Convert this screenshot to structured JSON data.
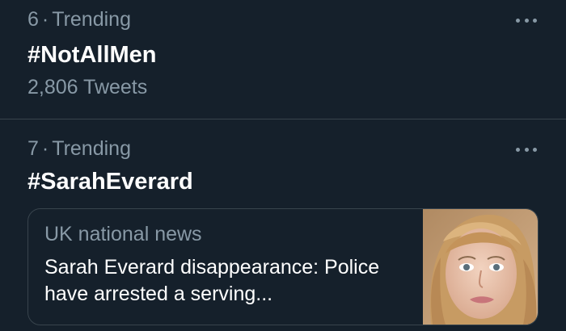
{
  "trends": [
    {
      "rank": "6",
      "separator": "·",
      "category": "Trending",
      "hashtag": "#NotAllMen",
      "tweet_count": "2,806 Tweets",
      "more_icon": "more-horizontal-icon"
    },
    {
      "rank": "7",
      "separator": "·",
      "category": "Trending",
      "hashtag": "#SarahEverard",
      "more_icon": "more-horizontal-icon",
      "news_card": {
        "source": "UK national news",
        "headline": "Sarah Everard disappearance: Police have arrested a serving...",
        "thumbnail": "portrait-photo"
      }
    }
  ],
  "colors": {
    "background": "#15202b",
    "divider": "#38444d",
    "primary_text": "#ffffff",
    "secondary_text": "#8899a6"
  }
}
